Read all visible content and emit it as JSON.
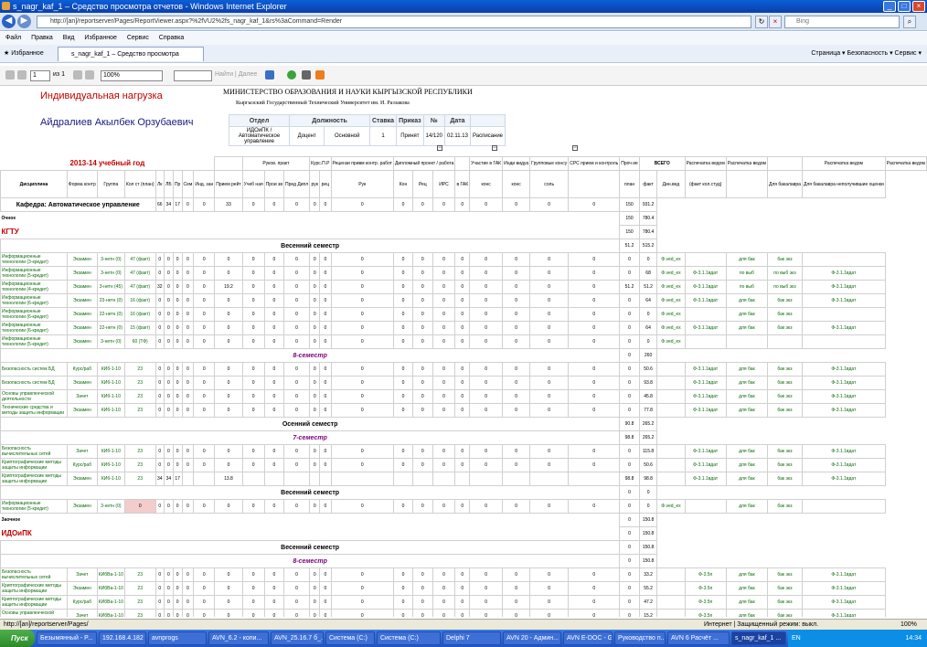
{
  "window": {
    "title": "s_nagr_kaf_1 – Средство просмотра отчетов - Windows Internet Explorer"
  },
  "address": {
    "url": "http://[an]/reportserver/Pages/ReportViewer.aspx?%2fVU2%2fs_nagr_kaf_1&rs%3aCommand=Render",
    "search_placeholder": "Bing"
  },
  "menu": [
    "Файл",
    "Правка",
    "Вид",
    "Избранное",
    "Сервис",
    "Справка"
  ],
  "favbar": {
    "favorites": "Избранное",
    "tab": "s_nagr_kaf_1 – Средство просмотра отчетов",
    "right": "Страница ▾   Безопасность ▾   Сервис ▾"
  },
  "report_toolbar": {
    "page": "1",
    "of": "из 1",
    "zoom": "100%",
    "find": "Найти",
    "next": "Далее"
  },
  "report": {
    "title": "Индивидуальная нагрузка",
    "person": "Айдралиев Акылбек Орзубаевич",
    "ministry": "МИНИСТЕРСТВО ОБРАЗОВАНИЯ И НАУКИ КЫРГЫЗСКОЙ РЕСПУБЛИКИ",
    "university": "Кыргызский Государственный Технический Университет им. И. Раззакова",
    "pos_headers": [
      "Отдел",
      "Должность",
      "Ставка",
      "Приказ",
      "№",
      "Дата"
    ],
    "pos_row": [
      "ИДОиПК / Автоматическое управление",
      "Доцент",
      "Основной",
      "1",
      "Принят",
      "14/120",
      "02.11.13",
      "Расписание"
    ],
    "year": "2013-14 учебный год",
    "group_headers": [
      "Руков. практ",
      "Курс.П.Р",
      "Рецензи привм контр. работ",
      "Дипломный проект / работа",
      "Участие в ГАК",
      "Инди видуа",
      "Групповые консу",
      "СРС прием и контроль",
      "Проч ие",
      "ВСЕГО",
      "Распечатка ведом",
      "Распечатка ведом",
      "Распечатка ведом",
      "Распечатка ведом"
    ],
    "col_headers": [
      "Дисциплина",
      "Форма контр",
      "Группа",
      "Кол ст (план)",
      "Лк",
      "ЛБ",
      "Пр",
      "Сем",
      "Инд. зан",
      "Прием рейт",
      "Учеб ная",
      "Прои зв",
      "Пред Дипл",
      "рук",
      "рец",
      "Рук",
      "Кон",
      "Рец",
      "ИРС",
      "в ГАК",
      "конс",
      "конс",
      "соль",
      "",
      "план",
      "факт",
      "Дин.вед",
      "(факт кол.студ)",
      "",
      "Для бакалавра",
      "Для бакалавра неполучившие оценки"
    ],
    "dept": "Кафедра: Автоматическое управление",
    "dept_vals": [
      "66",
      "34",
      "17",
      "0",
      "0",
      "33",
      "0",
      "0",
      "0",
      "0",
      "0",
      "0",
      "0",
      "0",
      "0",
      "0",
      "0",
      "0",
      "0",
      "0",
      "150",
      "931.2"
    ],
    "ochnoe": "Очное",
    "kgtu": "КГТУ",
    "idoipk": "ИДОиПК",
    "zaochnoe": "Заочное",
    "s_vesen": "Весенний семестр",
    "s_osen": "Осенний семестр",
    "sem8": "8-семестр",
    "sem7": "7-семестр",
    "totals": {
      "a": "150",
      "b": "780.4",
      "c": "150",
      "d": "780.4",
      "e": "51.2",
      "f": "515.2",
      "g": "0",
      "h": "260",
      "i": "90.8",
      "j": "265.2",
      "k": "98.8",
      "l": "265.2",
      "m": "0",
      "n": "0",
      "o": "0",
      "p": "150.8",
      "q": "0",
      "r": "150.8",
      "s": "0",
      "t": "150.8"
    },
    "rows1": [
      {
        "name": "Информационные технологии (3-кредит)",
        "form": "Экзамен",
        "grp": "3-нетн (0)",
        "n": "47 (факт)",
        "v": [
          "0",
          "0",
          "0",
          "0",
          "0",
          "0",
          "0",
          "0",
          "0",
          "0",
          "0",
          "0",
          "0",
          "0",
          "0",
          "0",
          "0",
          "0",
          "0",
          "0"
        ],
        "plan": "0",
        "fact": "0",
        "d1": "Ф.ved_ex",
        "d2": "",
        "d3": "для бак",
        "d4": "бак экз",
        "d5": "",
        "d6": ""
      },
      {
        "name": "Информационные технологии (5-кредит)",
        "form": "Экзамен",
        "grp": "3-нетн (0)",
        "n": "47 (факт)",
        "v": [
          "0",
          "0",
          "0",
          "0",
          "0",
          "0",
          "0",
          "0",
          "0",
          "0",
          "0",
          "0",
          "0",
          "0",
          "0",
          "0",
          "0",
          "0",
          "0",
          "0"
        ],
        "plan": "0",
        "fact": "68",
        "d1": "Ф.ved_ex",
        "d2": "Ф-3.1.1вдат",
        "d3": "по выб",
        "d4": "по выб экз",
        "d5": "Ф-3.1.1вдат",
        "d6": "Ф-3.1.2вдат"
      },
      {
        "name": "Информационные технологии (4-кредит)",
        "form": "Экзамен",
        "grp": "3-нетн (45)",
        "n": "47 (факт)",
        "v": [
          "32",
          "0",
          "0",
          "0",
          "0",
          "19.2",
          "0",
          "0",
          "0",
          "0",
          "0",
          "0",
          "0",
          "0",
          "0",
          "0",
          "0",
          "0",
          "0",
          "0"
        ],
        "plan": "51.2",
        "fact": "51.2",
        "d1": "Ф.ved_ex",
        "d2": "Ф-3.1.1вдат",
        "d3": "по выб",
        "d4": "по выб экз",
        "d5": "Ф-3.1.1вдат",
        "d6": "Ф-3.1.2вдат"
      },
      {
        "name": "Информационные технологии (6-кредит)",
        "form": "Экзамен",
        "grp": "23-нетн (0)",
        "n": "16 (факт)",
        "v": [
          "0",
          "0",
          "0",
          "0",
          "0",
          "0",
          "0",
          "0",
          "0",
          "0",
          "0",
          "0",
          "0",
          "0",
          "0",
          "0",
          "0",
          "0",
          "0",
          "0"
        ],
        "plan": "0",
        "fact": "64",
        "d1": "Ф.ved_ex",
        "d2": "Ф-3.1.1вдат",
        "d3": "для бак",
        "d4": "бак экз",
        "d5": "Ф-3.1.1вдат",
        "d6": "Ф-3.1.2вдат"
      },
      {
        "name": "Информационные технологии (6-кредит)",
        "form": "Экзамен",
        "grp": "22-нетн (0)",
        "n": "16 (факт)",
        "v": [
          "0",
          "0",
          "0",
          "0",
          "0",
          "0",
          "0",
          "0",
          "0",
          "0",
          "0",
          "0",
          "0",
          "0",
          "0",
          "0",
          "0",
          "0",
          "0",
          "0"
        ],
        "plan": "0",
        "fact": "0",
        "d1": "Ф.ved_ex",
        "d2": "",
        "d3": "для бак",
        "d4": "бак экз",
        "d5": "",
        "d6": ""
      },
      {
        "name": "Информационные технологии (6-кредит)",
        "form": "Экзамен",
        "grp": "22-нетн (0)",
        "n": "15 (факт)",
        "v": [
          "0",
          "0",
          "0",
          "0",
          "0",
          "0",
          "0",
          "0",
          "0",
          "0",
          "0",
          "0",
          "0",
          "0",
          "0",
          "0",
          "0",
          "0",
          "0",
          "0"
        ],
        "plan": "0",
        "fact": "64",
        "d1": "Ф.ved_ex",
        "d2": "Ф-3.1.1вдат",
        "d3": "для бак",
        "d4": "бак экз",
        "d5": "Ф-3.1.1вдат",
        "d6": "Ф-3.1.2вдат"
      },
      {
        "name": "Информационные технологии (5-кредит)",
        "form": "Экзамен",
        "grp": "3-нетн (0)",
        "n": "60 (ТФ)",
        "v": [
          "0",
          "0",
          "0",
          "0",
          "0",
          "0",
          "0",
          "0",
          "0",
          "0",
          "0",
          "0",
          "0",
          "0",
          "0",
          "0",
          "0",
          "0",
          "0",
          "0"
        ],
        "plan": "0",
        "fact": "0",
        "d1": "Ф.ved_ex",
        "d2": "",
        "d3": "",
        "d4": "",
        "d5": "",
        "d6": ""
      }
    ],
    "rows2": [
      {
        "name": "Безопасность систем БД",
        "form": "Курс/раб",
        "grp": "КИб-1-10",
        "n": "23",
        "v": [
          "0",
          "0",
          "0",
          "0",
          "0",
          "0",
          "0",
          "0",
          "0",
          "0",
          "0",
          "0",
          "0",
          "0",
          "0",
          "0",
          "0",
          "0",
          "0",
          "0"
        ],
        "plan": "0",
        "fact": "50.6",
        "d2": "Ф-3.1.1вдат",
        "d3": "для бак",
        "d4": "бак экз",
        "d5": "Ф-3.1.1вдат",
        "d6": "Ф-3.1.2вдат"
      },
      {
        "name": "Безопасность систем БД",
        "form": "Экзамен",
        "grp": "КИб-1-10",
        "n": "23",
        "v": [
          "0",
          "0",
          "0",
          "0",
          "0",
          "0",
          "0",
          "0",
          "0",
          "0",
          "0",
          "0",
          "0",
          "0",
          "0",
          "0",
          "0",
          "0",
          "0",
          "0"
        ],
        "plan": "0",
        "fact": "93.8",
        "d2": "Ф-3.1.1вдат",
        "d3": "для бак",
        "d4": "бак экз",
        "d5": "Ф-3.1.1вдат",
        "d6": "Ф-3.1.2вдат"
      },
      {
        "name": "Основы управленческой деятельности",
        "form": "Зачет",
        "grp": "КИб-1-10",
        "n": "23",
        "v": [
          "0",
          "0",
          "0",
          "0",
          "0",
          "0",
          "0",
          "0",
          "0",
          "0",
          "0",
          "0",
          "0",
          "0",
          "0",
          "0",
          "0",
          "0",
          "0",
          "0"
        ],
        "plan": "0",
        "fact": "45.8",
        "d2": "Ф-3.1.1вдат",
        "d3": "для бак",
        "d4": "бак экз",
        "d5": "Ф-3.1.1вдат",
        "d6": "Ф-3.1.2вдат"
      },
      {
        "name": "Технические средства и методы защиты информации",
        "form": "Экзамен",
        "grp": "КИб-1-10",
        "n": "23",
        "v": [
          "0",
          "0",
          "0",
          "0",
          "0",
          "0",
          "0",
          "0",
          "0",
          "0",
          "0",
          "0",
          "0",
          "0",
          "0",
          "0",
          "0",
          "0",
          "0",
          "0"
        ],
        "plan": "0",
        "fact": "77.8",
        "d2": "Ф-3.1.1вдат",
        "d3": "для бак",
        "d4": "бак экз",
        "d5": "Ф-3.1.1вдат",
        "d6": "Ф-3.1.2вдат"
      }
    ],
    "rows3": [
      {
        "name": "Безопасность вычислительных сетей",
        "form": "Зачет",
        "grp": "КИб-1-10",
        "n": "23",
        "v": [
          "0",
          "0",
          "0",
          "0",
          "0",
          "0",
          "0",
          "0",
          "0",
          "0",
          "0",
          "0",
          "0",
          "0",
          "0",
          "0",
          "0",
          "0",
          "0",
          "0"
        ],
        "plan": "0",
        "fact": "115.8",
        "d2": "Ф-3.1.1вдат",
        "d3": "для бак",
        "d4": "бак экз",
        "d5": "Ф-3.1.1вдат",
        "d6": "Ф-3.1.2вдат"
      },
      {
        "name": "Криптографические методы защиты информации",
        "form": "Курс/раб",
        "grp": "КИб-1-10",
        "n": "23",
        "v": [
          "0",
          "0",
          "0",
          "0",
          "0",
          "0",
          "0",
          "0",
          "0",
          "0",
          "0",
          "0",
          "0",
          "0",
          "0",
          "0",
          "0",
          "0",
          "0",
          "0"
        ],
        "plan": "0",
        "fact": "50.6",
        "d2": "Ф-3.1.1вдат",
        "d3": "для бак",
        "d4": "бак экз",
        "d5": "Ф-3.1.1вдат",
        "d6": "Ф-3.1.2вдат"
      },
      {
        "name": "Криптографические методы защиты информации",
        "form": "Экзамен",
        "grp": "КИб-1-10",
        "n": "23",
        "v": [
          "34",
          "34",
          "17",
          "",
          "",
          "13.8",
          "",
          "",
          "",
          "",
          "",
          "",
          "",
          "",
          "",
          "",
          "",
          "",
          "",
          ""
        ],
        "plan": "98.8",
        "fact": "98.8",
        "d2": "Ф-3.1.1вдат",
        "d3": "для бак",
        "d4": "бак экз",
        "d5": "Ф-3.1.1вдат",
        "d6": "Ф-3.1.2вдат"
      }
    ],
    "rows4": [
      {
        "name": "Информационные технологии (5-кредит)",
        "form": "Экзамен",
        "grp": "3-нетн (0)",
        "n": "0",
        "v": [
          "0",
          "0",
          "0",
          "0",
          "0",
          "0",
          "0",
          "0",
          "0",
          "0",
          "0",
          "0",
          "0",
          "0",
          "0",
          "0",
          "0",
          "0",
          "0",
          "0"
        ],
        "plan": "0",
        "fact": "0",
        "d1": "Ф.ved_ex",
        "d3": "для бак",
        "d4": "бак экз"
      }
    ],
    "rows5": [
      {
        "name": "Безопасность вычислительных сетей",
        "form": "Зачет",
        "grp": "КИбВа-1-10",
        "n": "23",
        "v": [
          "0",
          "0",
          "0",
          "0",
          "0",
          "0",
          "0",
          "0",
          "0",
          "0",
          "0",
          "0",
          "0",
          "0",
          "0",
          "0",
          "0",
          "0",
          "0",
          "0"
        ],
        "plan": "0",
        "fact": "33.2",
        "d2": "Ф-3.5п",
        "d3": "для бак",
        "d4": "бак экз",
        "d5": "Ф-3.1.1вдат",
        "d6": "Ф-3.1.2вдат"
      },
      {
        "name": "Криптографические методы защиты информации",
        "form": "Экзамен",
        "grp": "КИбВа-1-10",
        "n": "23",
        "v": [
          "0",
          "0",
          "0",
          "0",
          "0",
          "0",
          "0",
          "0",
          "0",
          "0",
          "0",
          "0",
          "0",
          "0",
          "0",
          "0",
          "0",
          "0",
          "0",
          "0"
        ],
        "plan": "0",
        "fact": "55.2",
        "d2": "Ф-3.5п",
        "d3": "для бак",
        "d4": "бак экз",
        "d5": "Ф-3.1.1вдат",
        "d6": "Ф-3.1.2вдат"
      },
      {
        "name": "Криптографические методы защиты информации",
        "form": "Курс/раб",
        "grp": "КИбВа-1-10",
        "n": "23",
        "v": [
          "0",
          "0",
          "0",
          "0",
          "0",
          "0",
          "0",
          "0",
          "0",
          "0",
          "0",
          "0",
          "0",
          "0",
          "0",
          "0",
          "0",
          "0",
          "0",
          "0"
        ],
        "plan": "0",
        "fact": "47.2",
        "d2": "Ф-3.5п",
        "d3": "для бак",
        "d4": "бак экз",
        "d5": "Ф-3.1.1вдат",
        "d6": "Ф-3.1.2вдат"
      },
      {
        "name": "Основы управленческой деятельности",
        "form": "Зачет",
        "grp": "КИбВа-1-10",
        "n": "23",
        "v": [
          "0",
          "0",
          "0",
          "0",
          "0",
          "0",
          "0",
          "0",
          "0",
          "0",
          "0",
          "0",
          "0",
          "0",
          "0",
          "0",
          "0",
          "0",
          "0",
          "0"
        ],
        "plan": "0",
        "fact": "15.2",
        "d2": "Ф-3.5п",
        "d3": "для бак",
        "d4": "бак экз",
        "d5": "Ф-3.1.1вдат",
        "d6": "Ф-3.1.2вдат"
      }
    ]
  },
  "statusbar": {
    "left": "http://[an]/reportserver/Pages/",
    "zone": "Интернет | Защищенный режим: выкл.",
    "zoom": "100%"
  },
  "taskbar": {
    "start": "Пуск",
    "items": [
      "Безымянный - P...",
      "192.168.4.182 -...",
      "avnprogs",
      "AVN_6.2 - копи...",
      "AVN_25.16.7 б_...",
      "Система (C:)",
      "Система (C:)",
      "Delphi 7",
      "AVN 20 - Админ...",
      "AVN E-DOC - Go...",
      "Руководство п...",
      "AVN 6  Расчёт ...",
      "s_nagr_kaf_1 ..."
    ],
    "lang": "EN",
    "clock": "14:34"
  }
}
